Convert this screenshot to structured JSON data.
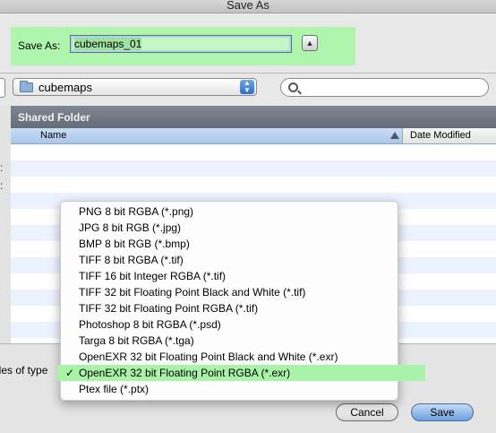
{
  "window": {
    "title": "Save As"
  },
  "save_as": {
    "label": "Save As:",
    "filename": "cubemaps_01"
  },
  "location": {
    "folder": "cubemaps"
  },
  "sidebar": {
    "fragments": [
      ":",
      ":"
    ]
  },
  "browser": {
    "section_header": "Shared Folder",
    "columns": {
      "name": "Name",
      "date": "Date Modified"
    }
  },
  "format": {
    "label": "iles of type",
    "options": [
      "PNG 8 bit RGBA (*.png)",
      "JPG 8 bit RGB (*.jpg)",
      "BMP 8 bit RGB (*.bmp)",
      "TIFF 8 bit RGBA (*.tif)",
      "TIFF 16 bit Integer RGBA (*.tif)",
      "TIFF 32 bit Floating Point Black and White (*.tif)",
      "TIFF 32 bit Floating Point RGBA (*.tif)",
      "Photoshop 8 bit RGBA (*.psd)",
      "Targa 8 bit RGBA (*.tga)",
      "OpenEXR 32 bit Floating Point Black and White (*.exr)",
      "OpenEXR 32 bit Floating Point RGBA (*.exr)",
      "Ptex file (*.ptx)"
    ],
    "selected": "OpenEXR 32 bit Floating Point RGBA (*.exr)",
    "check_mark": "✓"
  },
  "buttons": {
    "cancel": "Cancel",
    "save": "Save"
  },
  "colors": {
    "highlight": "#aef5ae",
    "header": "#6f7782",
    "stripe": "#edf3fe"
  }
}
